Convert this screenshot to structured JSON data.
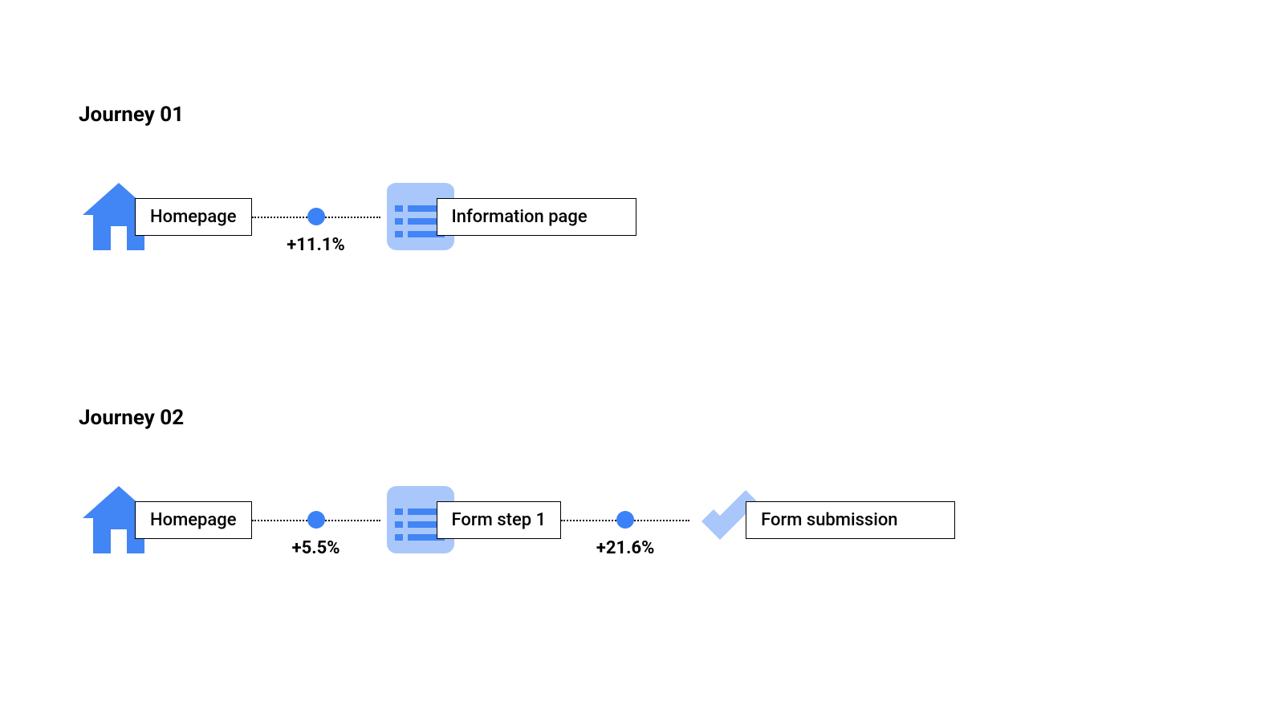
{
  "journeys": [
    {
      "title": "Journey 01",
      "steps": [
        {
          "icon": "home",
          "label": "Homepage"
        },
        {
          "icon": "list",
          "label": "Information page"
        }
      ],
      "connectors": [
        {
          "value": "+11.1%"
        }
      ]
    },
    {
      "title": "Journey 02",
      "steps": [
        {
          "icon": "home",
          "label": "Homepage"
        },
        {
          "icon": "list",
          "label": "Form step 1"
        },
        {
          "icon": "check",
          "label": "Form submission"
        }
      ],
      "connectors": [
        {
          "value": "+5.5%"
        },
        {
          "value": "+21.6%"
        }
      ]
    }
  ],
  "colors": {
    "primary": "#4285f4",
    "primary_light": "#a9c7fa",
    "dot": "#3b82f6"
  }
}
